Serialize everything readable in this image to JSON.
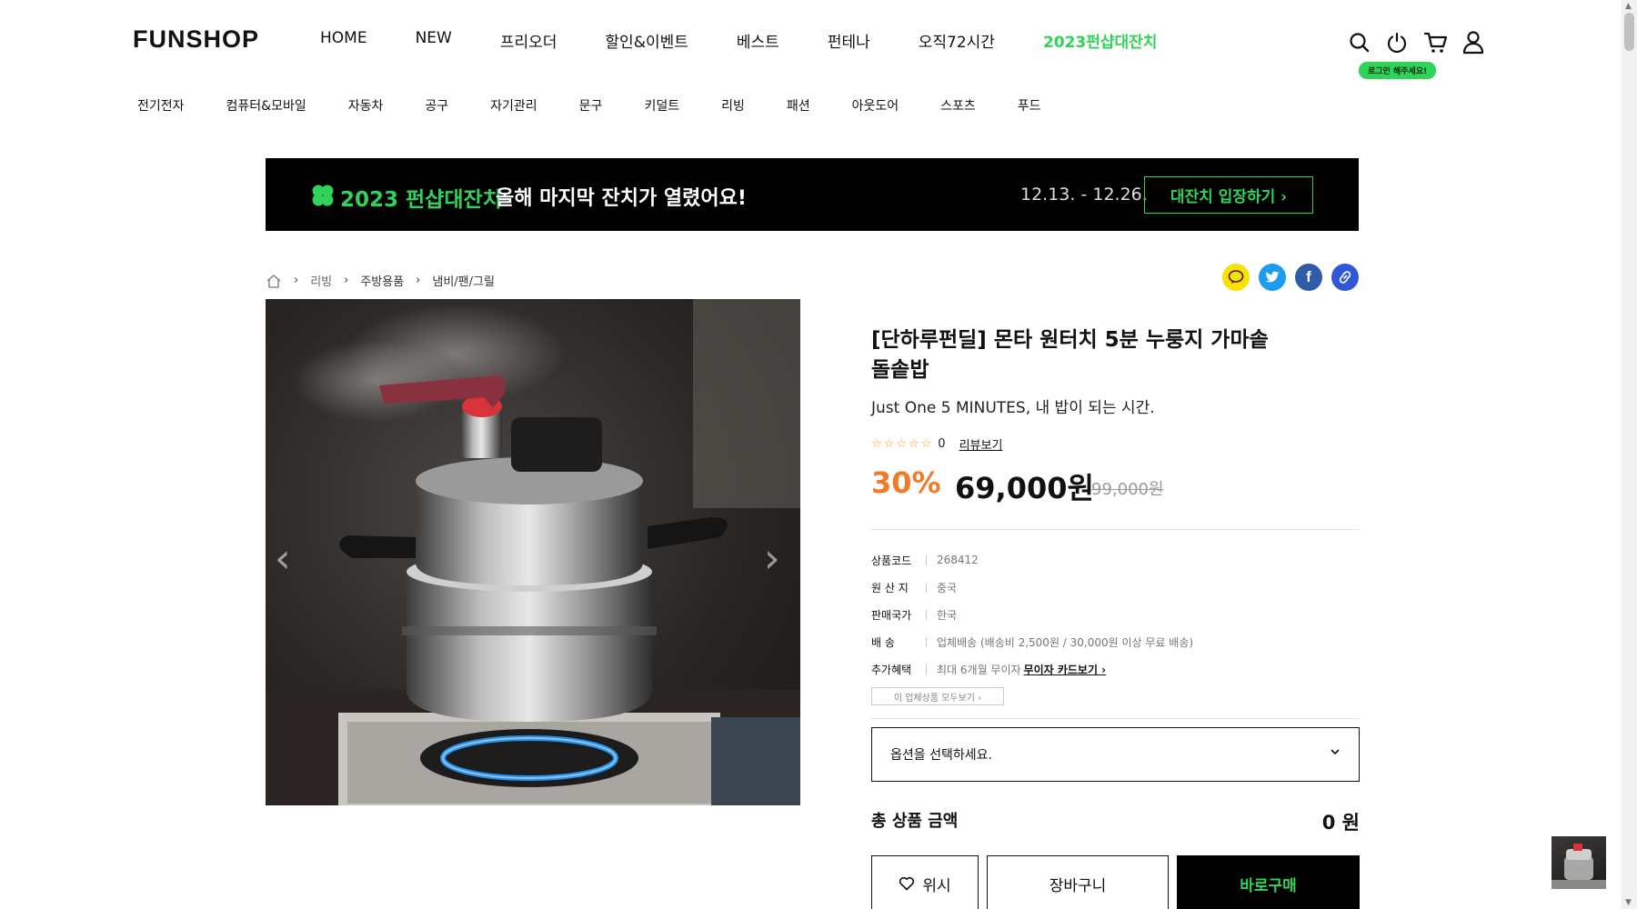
{
  "header": {
    "logo": "FUNSHOP",
    "main_nav": [
      "HOME",
      "NEW",
      "프리오더",
      "할인&이벤트",
      "베스트",
      "펀테나",
      "오직72시간",
      "2023펀샵대잔치"
    ],
    "login_tip": "로그인 해주세요!",
    "icons": [
      "search-icon",
      "power-icon",
      "cart-icon",
      "user-icon"
    ]
  },
  "category_nav": [
    "전기전자",
    "컴퓨터&모바일",
    "자동차",
    "공구",
    "자기관리",
    "문구",
    "키덜트",
    "리빙",
    "패션",
    "아웃도어",
    "스포츠",
    "푸드"
  ],
  "banner": {
    "title": "2023 펀샵대잔치",
    "subtitle": "올해 마지막 잔치가 열렸어요!",
    "dates": "12.13. - 12.26.",
    "button": "대잔치 입장하기 ›"
  },
  "breadcrumb": [
    "리빙",
    "주방용품",
    "냄비/팬/그릴"
  ],
  "share_icons": [
    "kakaotalk-icon",
    "twitter-icon",
    "facebook-icon",
    "link-icon"
  ],
  "product": {
    "title": "[단하루펀딜] 몬타 원터치 5분 누룽지 가마솥 돌솥밥",
    "subtitle": "Just One 5 MINUTES, 내 밥이 되는 시간.",
    "stars": "☆☆☆☆☆",
    "rating": 0,
    "review_count": "0",
    "review_link": "리뷰보기",
    "discount": "30%",
    "price": "69,000원",
    "original_price": "99,000원",
    "info": [
      {
        "label": "상품코드",
        "value": "268412"
      },
      {
        "label": "원 산 지",
        "value": "중국"
      },
      {
        "label": "판매국가",
        "value": "한국"
      },
      {
        "label": "배 송",
        "value": "업체배송 (배송비 2,500원 / 30,000원 이상 무료 배송)"
      },
      {
        "label": "추가혜택",
        "value": "최대 6개월 무이자",
        "link": "무이자 카드보기 ›"
      }
    ],
    "vendor_button": "이 업체상품 모두보기 ›",
    "option_placeholder": "옵션을 선택하세요.",
    "total_label": "총 상품 금액",
    "total_value": "0 원",
    "wish_label": "위시",
    "cart_label": "장바구니",
    "buy_label": "바로구매"
  },
  "colors": {
    "accent_green": "#2fd35a",
    "discount_orange": "#f27b2b",
    "star": "#f3a21a"
  }
}
